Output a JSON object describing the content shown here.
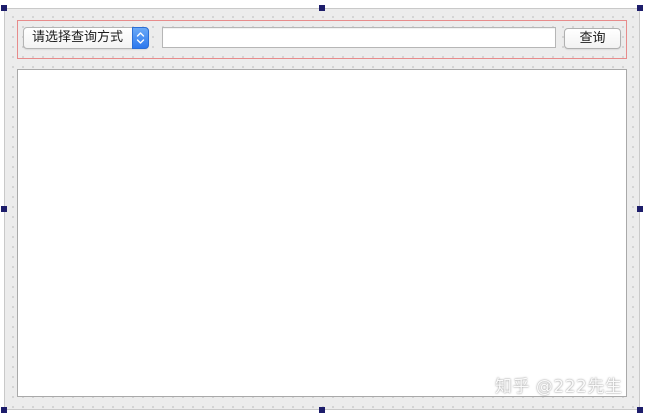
{
  "toolbar": {
    "query_mode_select": {
      "selected_label": "请选择查询方式"
    },
    "search_input": {
      "value": "",
      "placeholder": ""
    },
    "query_button_label": "查询"
  },
  "results": {
    "content": ""
  },
  "watermark": {
    "text": "知乎 @222先生"
  },
  "colors": {
    "canvas_background": "#ececec",
    "layout_outline": "#e78b8b",
    "selection_handle": "#1d1d6b",
    "combo_arrow_accent": "#2d79ee"
  },
  "icons": {
    "combo_arrow": "chevron-up-down-icon"
  }
}
